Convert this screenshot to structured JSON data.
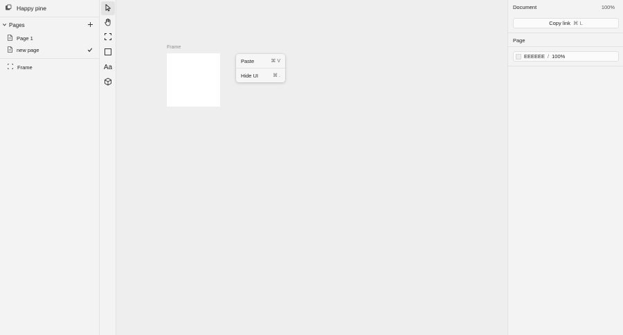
{
  "project": {
    "title": "Happy pine"
  },
  "pages": {
    "header": "Pages",
    "items": [
      {
        "label": "Page 1",
        "checked": false
      },
      {
        "label": "new page",
        "checked": true
      }
    ]
  },
  "layers": [
    {
      "label": "Frame"
    }
  ],
  "toolbar": {
    "tools": [
      {
        "name": "pointer-tool",
        "icon": "pointer-icon",
        "active": true
      },
      {
        "name": "hand-tool",
        "icon": "hand-icon"
      },
      {
        "name": "frame-tool",
        "icon": "frame-icon"
      },
      {
        "name": "rectangle-tool",
        "icon": "rectangle-icon"
      },
      {
        "name": "text-tool",
        "icon": "text-icon",
        "label": "Aa"
      },
      {
        "name": "component-tool",
        "icon": "cube-icon"
      }
    ]
  },
  "canvas": {
    "frame_label": "Frame",
    "background": "#EEEEEE"
  },
  "context_menu": {
    "items": [
      {
        "label": "Paste",
        "shortcut": "⌘ V"
      },
      {
        "label": "Hide UI",
        "shortcut": "⌘ ."
      }
    ]
  },
  "inspector": {
    "document_label": "Document",
    "zoom": "100%",
    "copy_link_label": "Copy link",
    "copy_link_shortcut": "⌘ L",
    "page_label": "Page",
    "page_bg_hex": "EEEEEE",
    "page_bg_opacity": "100%"
  }
}
